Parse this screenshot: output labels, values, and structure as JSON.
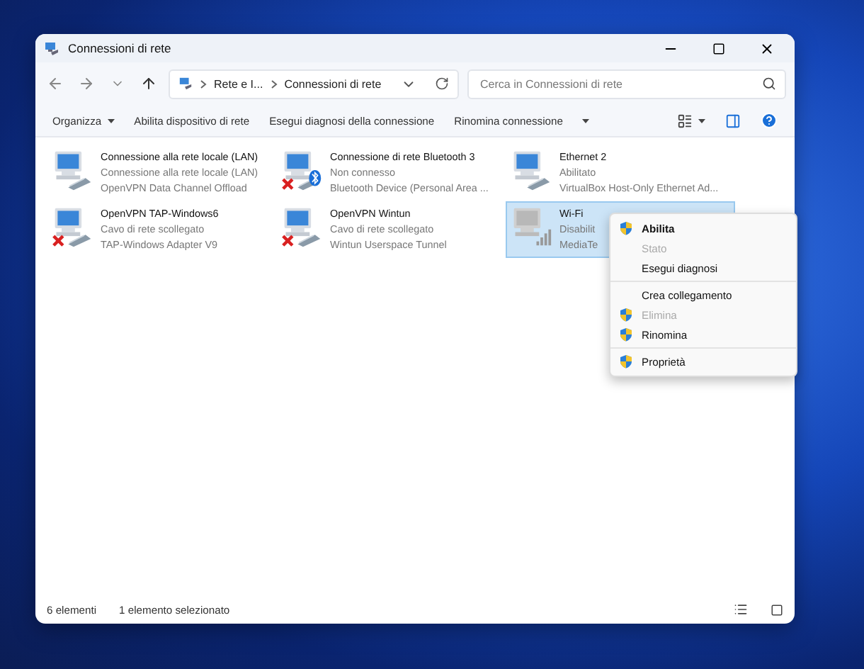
{
  "window": {
    "title": "Connessioni di rete"
  },
  "address": {
    "crumbs": [
      "Rete e I...",
      "Connessioni di rete"
    ]
  },
  "search": {
    "placeholder": "Cerca in Connessioni di rete"
  },
  "toolbar": {
    "items": [
      "Organizza",
      "Abilita dispositivo di rete",
      "Esegui diagnosi della connessione",
      "Rinomina connessione"
    ]
  },
  "connections": [
    {
      "name": "Connessione alla rete locale (LAN)",
      "status": "Connessione alla rete locale (LAN)",
      "device": "OpenVPN Data Channel Offload",
      "kind": "ethernet",
      "disconnected": false,
      "bluetooth": false,
      "disabled": false,
      "selected": false
    },
    {
      "name": "Connessione di rete Bluetooth 3",
      "status": "Non connesso",
      "device": "Bluetooth Device (Personal Area ...",
      "kind": "ethernet",
      "disconnected": true,
      "bluetooth": true,
      "disabled": false,
      "selected": false
    },
    {
      "name": "Ethernet 2",
      "status": "Abilitato",
      "device": "VirtualBox Host-Only Ethernet Ad...",
      "kind": "ethernet",
      "disconnected": false,
      "bluetooth": false,
      "disabled": false,
      "selected": false
    },
    {
      "name": "OpenVPN TAP-Windows6",
      "status": "Cavo di rete scollegato",
      "device": "TAP-Windows Adapter V9",
      "kind": "ethernet",
      "disconnected": true,
      "bluetooth": false,
      "disabled": false,
      "selected": false
    },
    {
      "name": "OpenVPN Wintun",
      "status": "Cavo di rete scollegato",
      "device": "Wintun Userspace Tunnel",
      "kind": "ethernet",
      "disconnected": true,
      "bluetooth": false,
      "disabled": false,
      "selected": false
    },
    {
      "name": "Wi-Fi",
      "status": "Disabilit",
      "device": "MediaTe",
      "kind": "wifi",
      "disconnected": false,
      "bluetooth": false,
      "disabled": true,
      "selected": true
    }
  ],
  "context_menu": {
    "items": [
      {
        "kind": "item",
        "label": "Abilita",
        "shield": true,
        "bold": true,
        "disabled": false
      },
      {
        "kind": "item",
        "label": "Stato",
        "shield": false,
        "bold": false,
        "disabled": true
      },
      {
        "kind": "item",
        "label": "Esegui diagnosi",
        "shield": false,
        "bold": false,
        "disabled": false
      },
      {
        "kind": "separator"
      },
      {
        "kind": "item",
        "label": "Crea collegamento",
        "shield": false,
        "bold": false,
        "disabled": false
      },
      {
        "kind": "item",
        "label": "Elimina",
        "shield": true,
        "bold": false,
        "disabled": true
      },
      {
        "kind": "item",
        "label": "Rinomina",
        "shield": true,
        "bold": false,
        "disabled": false
      },
      {
        "kind": "separator"
      },
      {
        "kind": "item",
        "label": "Proprietà",
        "shield": true,
        "bold": false,
        "disabled": false
      }
    ]
  },
  "status_bar": {
    "count": "6 elementi",
    "selection": "1 elemento selezionato"
  }
}
